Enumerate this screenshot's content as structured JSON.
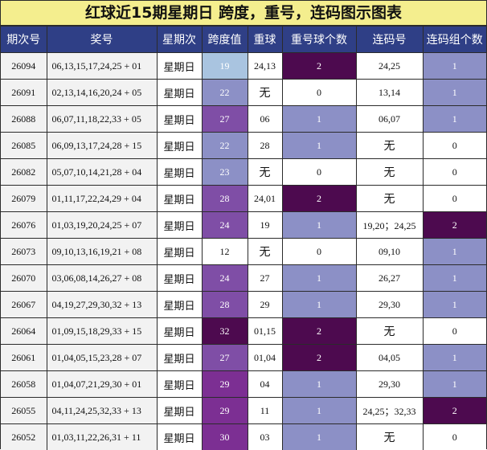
{
  "title": "红球近15期星期日 跨度，重号，连码图示图表",
  "headers": [
    "期次号",
    "奖号",
    "星期次",
    "跨度值",
    "重球",
    "重号球个数",
    "连码号",
    "连码组个数"
  ],
  "colors": {
    "header_bg": "#2f3f86",
    "title_bg": "#f4ee8e",
    "cell_lavender": "#8c90c6",
    "cell_light_blue": "#a9c4e0",
    "cell_purple_mid": "#7f4ea6",
    "cell_purple": "#7c2f93",
    "cell_deep_purple": "#4d0a4f"
  },
  "rows": [
    {
      "issue": "26094",
      "numbers": "06,13,15,17,24,25 + 01",
      "weekday": "星期日",
      "span": "19",
      "repeat_balls": "24,13",
      "repeat_count": "2",
      "consecutive": "24,25",
      "consecutive_groups": "1"
    },
    {
      "issue": "26091",
      "numbers": "02,13,14,16,20,24 + 05",
      "weekday": "星期日",
      "span": "22",
      "repeat_balls": "无",
      "repeat_count": "0",
      "consecutive": "13,14",
      "consecutive_groups": "1"
    },
    {
      "issue": "26088",
      "numbers": "06,07,11,18,22,33 + 05",
      "weekday": "星期日",
      "span": "27",
      "repeat_balls": "06",
      "repeat_count": "1",
      "consecutive": "06,07",
      "consecutive_groups": "1"
    },
    {
      "issue": "26085",
      "numbers": "06,09,13,17,24,28 + 15",
      "weekday": "星期日",
      "span": "22",
      "repeat_balls": "28",
      "repeat_count": "1",
      "consecutive": "无",
      "consecutive_groups": "0"
    },
    {
      "issue": "26082",
      "numbers": "05,07,10,14,21,28 + 04",
      "weekday": "星期日",
      "span": "23",
      "repeat_balls": "无",
      "repeat_count": "0",
      "consecutive": "无",
      "consecutive_groups": "0"
    },
    {
      "issue": "26079",
      "numbers": "01,11,17,22,24,29 + 04",
      "weekday": "星期日",
      "span": "28",
      "repeat_balls": "24,01",
      "repeat_count": "2",
      "consecutive": "无",
      "consecutive_groups": "0"
    },
    {
      "issue": "26076",
      "numbers": "01,03,19,20,24,25 + 07",
      "weekday": "星期日",
      "span": "24",
      "repeat_balls": "19",
      "repeat_count": "1",
      "consecutive": "19,20；24,25",
      "consecutive_groups": "2"
    },
    {
      "issue": "26073",
      "numbers": "09,10,13,16,19,21 + 08",
      "weekday": "星期日",
      "span": "12",
      "repeat_balls": "无",
      "repeat_count": "0",
      "consecutive": "09,10",
      "consecutive_groups": "1"
    },
    {
      "issue": "26070",
      "numbers": "03,06,08,14,26,27 + 08",
      "weekday": "星期日",
      "span": "24",
      "repeat_balls": "27",
      "repeat_count": "1",
      "consecutive": "26,27",
      "consecutive_groups": "1"
    },
    {
      "issue": "26067",
      "numbers": "04,19,27,29,30,32 + 13",
      "weekday": "星期日",
      "span": "28",
      "repeat_balls": "29",
      "repeat_count": "1",
      "consecutive": "29,30",
      "consecutive_groups": "1"
    },
    {
      "issue": "26064",
      "numbers": "01,09,15,18,29,33 + 15",
      "weekday": "星期日",
      "span": "32",
      "repeat_balls": "01,15",
      "repeat_count": "2",
      "consecutive": "无",
      "consecutive_groups": "0"
    },
    {
      "issue": "26061",
      "numbers": "01,04,05,15,23,28 + 07",
      "weekday": "星期日",
      "span": "27",
      "repeat_balls": "01,04",
      "repeat_count": "2",
      "consecutive": "04,05",
      "consecutive_groups": "1"
    },
    {
      "issue": "26058",
      "numbers": "01,04,07,21,29,30 + 01",
      "weekday": "星期日",
      "span": "29",
      "repeat_balls": "04",
      "repeat_count": "1",
      "consecutive": "29,30",
      "consecutive_groups": "1"
    },
    {
      "issue": "26055",
      "numbers": "04,11,24,25,32,33 + 13",
      "weekday": "星期日",
      "span": "29",
      "repeat_balls": "11",
      "repeat_count": "1",
      "consecutive": "24,25；32,33",
      "consecutive_groups": "2"
    },
    {
      "issue": "26052",
      "numbers": "01,03,11,22,26,31 + 11",
      "weekday": "星期日",
      "span": "30",
      "repeat_balls": "03",
      "repeat_count": "1",
      "consecutive": "无",
      "consecutive_groups": "0"
    }
  ]
}
